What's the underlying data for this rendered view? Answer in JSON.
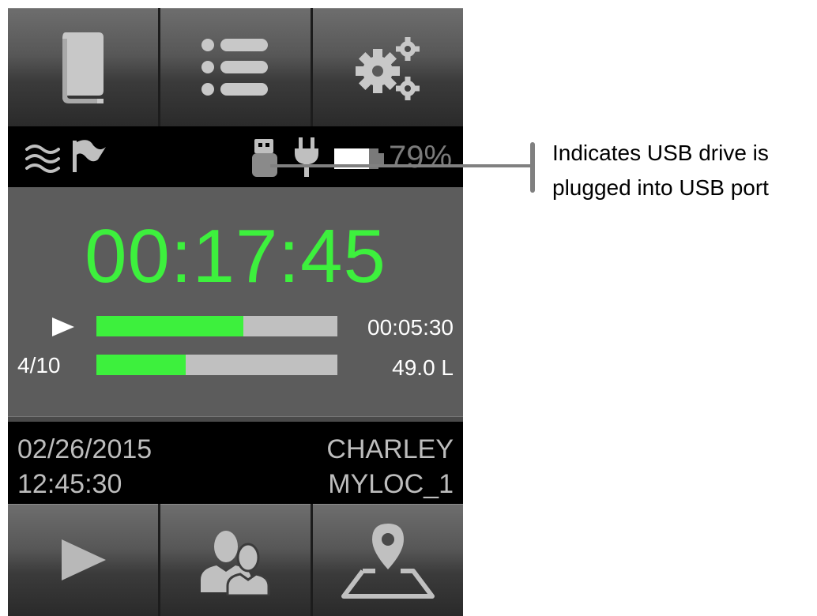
{
  "top_nav": {
    "buttons": [
      {
        "name": "manual",
        "icon": "book-icon"
      },
      {
        "name": "list",
        "icon": "list-icon"
      },
      {
        "name": "settings",
        "icon": "gears-icon"
      }
    ]
  },
  "status_bar": {
    "icons": [
      "waves-icon",
      "flag-icon",
      "usb-drive-icon",
      "power-plug-icon",
      "battery-icon"
    ],
    "battery_percent": "79%",
    "battery_level": 0.79
  },
  "run": {
    "timer": "00:17:45",
    "elapsed": "00:05:30",
    "elapsed_progress": 0.61,
    "count": "4/10",
    "count_progress": 0.37,
    "volume": "49.0 L",
    "play_indicator": "play-icon"
  },
  "info": {
    "date": "02/26/2015",
    "time": "12:45:30",
    "user": "CHARLEY",
    "location": "MYLOC_1"
  },
  "bottom_nav": {
    "buttons": [
      {
        "name": "play",
        "icon": "play-icon"
      },
      {
        "name": "users",
        "icon": "users-icon"
      },
      {
        "name": "location",
        "icon": "map-pin-icon"
      }
    ]
  },
  "callout": {
    "line1": "Indicates USB drive is",
    "line2": "plugged into USB port"
  },
  "colors": {
    "accent_green": "#3df03d",
    "icon_gray": "#c8c8c8",
    "panel_gray": "#5c5c5c"
  }
}
